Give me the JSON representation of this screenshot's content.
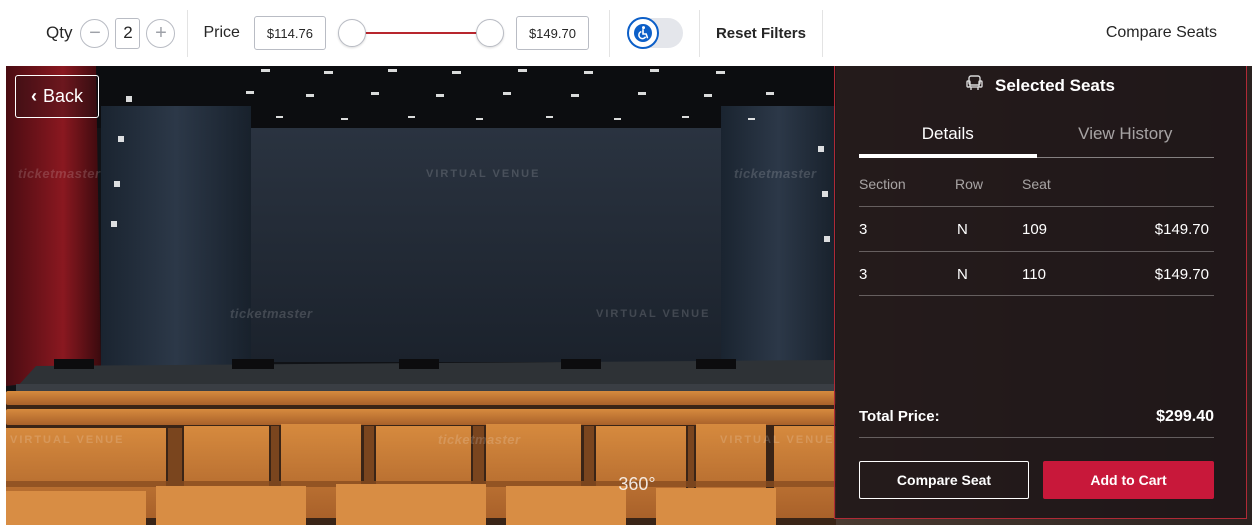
{
  "toolbar": {
    "qty_label": "Qty",
    "qty_value": "2",
    "minus_glyph": "−",
    "plus_glyph": "+",
    "price_label": "Price",
    "price_min": "$114.76",
    "price_max": "$149.70",
    "reset_filters": "Reset Filters",
    "compare_seats": "Compare Seats",
    "accessibility_icon": "wheelchair-icon",
    "slider_accent": "#b8262e"
  },
  "venue": {
    "back_label": "Back",
    "watermarks": {
      "ticketmaster": "ticketmaster",
      "virtual_venue": "VIRTUAL VENUE"
    },
    "view_360": "360°"
  },
  "panel": {
    "title": "Selected Seats",
    "tabs": [
      "Details",
      "View History"
    ],
    "columns": [
      "Section",
      "Row",
      "Seat"
    ],
    "rows": [
      {
        "section": "3",
        "row": "N",
        "seat": "109",
        "price": "$149.70"
      },
      {
        "section": "3",
        "row": "N",
        "seat": "110",
        "price": "$149.70"
      }
    ],
    "total_label": "Total Price:",
    "total_value": "$299.40",
    "compare_seat": "Compare Seat",
    "add_to_cart": "Add to Cart",
    "accent": "#c8183a"
  }
}
